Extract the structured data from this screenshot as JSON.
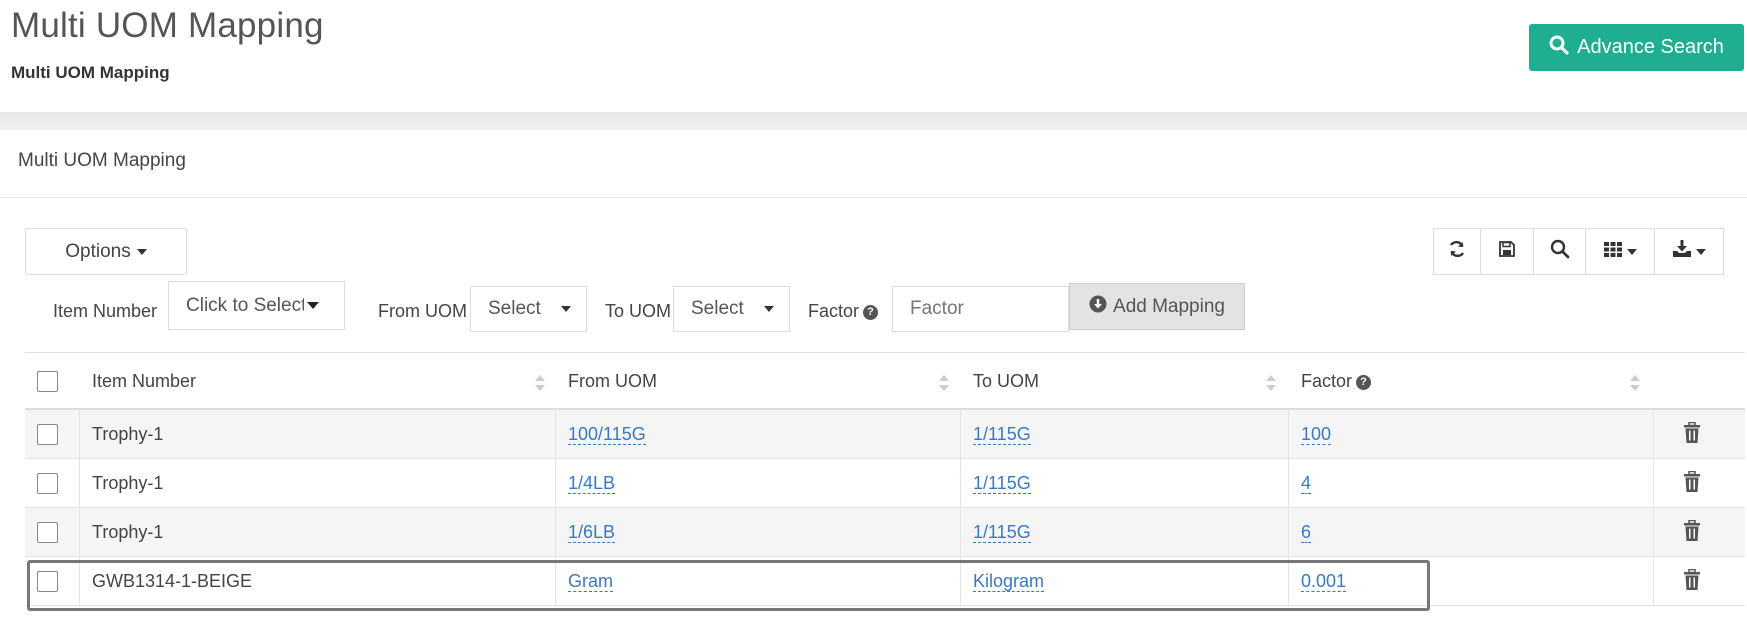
{
  "header": {
    "title": "Multi UOM Mapping",
    "subtitle": "Multi UOM Mapping",
    "advance_search_label": "Advance Search"
  },
  "panel": {
    "title": "Multi UOM Mapping"
  },
  "toolbar": {
    "options_label": "Options",
    "icons": [
      "refresh-icon",
      "save-icon",
      "search-icon",
      "columns-icon",
      "export-icon"
    ]
  },
  "filters": {
    "item_number_label": "Item Number",
    "item_number_value": "Click to Select",
    "from_uom_label": "From UOM",
    "from_uom_value": "Select",
    "to_uom_label": "To UOM",
    "to_uom_value": "Select",
    "factor_label": "Factor",
    "factor_placeholder": "Factor",
    "add_mapping_label": "Add Mapping"
  },
  "table": {
    "columns": [
      "Item Number",
      "From UOM",
      "To UOM",
      "Factor"
    ],
    "rows": [
      {
        "item_number": "Trophy-1",
        "from_uom": "100/115G",
        "to_uom": "1/115G",
        "factor": "100"
      },
      {
        "item_number": "Trophy-1",
        "from_uom": "1/4LB",
        "to_uom": "1/115G",
        "factor": "4"
      },
      {
        "item_number": "Trophy-1",
        "from_uom": "1/6LB",
        "to_uom": "1/115G",
        "factor": "6"
      },
      {
        "item_number": "GWB1314-1-BEIGE",
        "from_uom": "Gram",
        "to_uom": "Kilogram",
        "factor": "0.001"
      }
    ]
  },
  "colors": {
    "accent": "#1fae8f",
    "link": "#3a79c0",
    "row_alt": "#f5f5f5"
  }
}
